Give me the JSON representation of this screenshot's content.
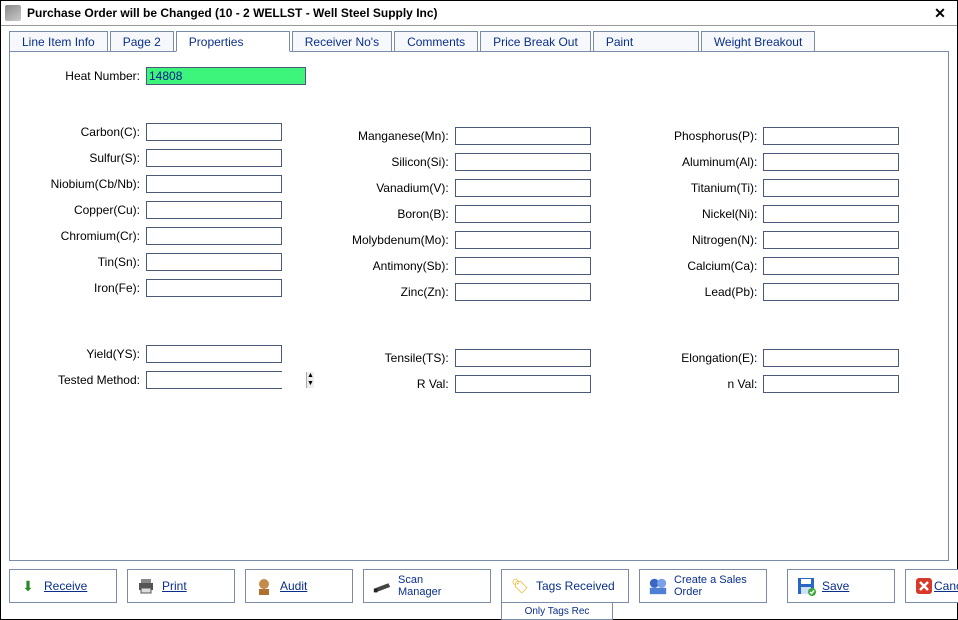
{
  "window": {
    "title": "Purchase Order will be Changed  (10 - 2  WELLST - Well Steel Supply Inc)"
  },
  "tabs": {
    "line_item_info": "Line Item Info",
    "page2": "Page 2",
    "properties": "Properties",
    "receiver_nos": "Receiver No's",
    "comments": "Comments",
    "price_break_out": "Price Break Out",
    "paint": "Paint",
    "weight_breakout": "Weight Breakout"
  },
  "form": {
    "heat_number": {
      "label": "Heat Number:",
      "value": "14808"
    },
    "carbon": {
      "label": "Carbon(C):",
      "value": ""
    },
    "sulfur": {
      "label": "Sulfur(S):",
      "value": ""
    },
    "niobium": {
      "label": "Niobium(Cb/Nb):",
      "value": ""
    },
    "copper": {
      "label": "Copper(Cu):",
      "value": ""
    },
    "chromium": {
      "label": "Chromium(Cr):",
      "value": ""
    },
    "tin": {
      "label": "Tin(Sn):",
      "value": ""
    },
    "iron": {
      "label": "Iron(Fe):",
      "value": ""
    },
    "manganese": {
      "label": "Manganese(Mn):",
      "value": ""
    },
    "silicon": {
      "label": "Silicon(Si):",
      "value": ""
    },
    "vanadium": {
      "label": "Vanadium(V):",
      "value": ""
    },
    "boron": {
      "label": "Boron(B):",
      "value": ""
    },
    "molybdenum": {
      "label": "Molybdenum(Mo):",
      "value": ""
    },
    "antimony": {
      "label": "Antimony(Sb):",
      "value": ""
    },
    "zinc": {
      "label": "Zinc(Zn):",
      "value": ""
    },
    "phosphorus": {
      "label": "Phosphorus(P):",
      "value": ""
    },
    "aluminum": {
      "label": "Aluminum(Al):",
      "value": ""
    },
    "titanium": {
      "label": "Titanium(Ti):",
      "value": ""
    },
    "nickel": {
      "label": "Nickel(Ni):",
      "value": ""
    },
    "nitrogen": {
      "label": "Nitrogen(N):",
      "value": ""
    },
    "calcium": {
      "label": "Calcium(Ca):",
      "value": ""
    },
    "lead": {
      "label": "Lead(Pb):",
      "value": ""
    },
    "yield": {
      "label": "Yield(YS):",
      "value": ""
    },
    "tensile": {
      "label": "Tensile(TS):",
      "value": ""
    },
    "elongation": {
      "label": "Elongation(E):",
      "value": ""
    },
    "tested_method": {
      "label": "Tested Method:",
      "value": ""
    },
    "r_val": {
      "label": "R Val:",
      "value": ""
    },
    "n_val": {
      "label": "n Val:",
      "value": ""
    }
  },
  "buttons": {
    "receive": "Receive",
    "print": "Print",
    "audit": "Audit",
    "scan_manager_l1": "Scan",
    "scan_manager_l2": "Manager",
    "tags_received": "Tags Received",
    "only_tags_rec": "Only Tags Rec",
    "create_sales_l1": "Create a Sales",
    "create_sales_l2": "Order",
    "save": "Save",
    "cancel": "Cancel"
  }
}
